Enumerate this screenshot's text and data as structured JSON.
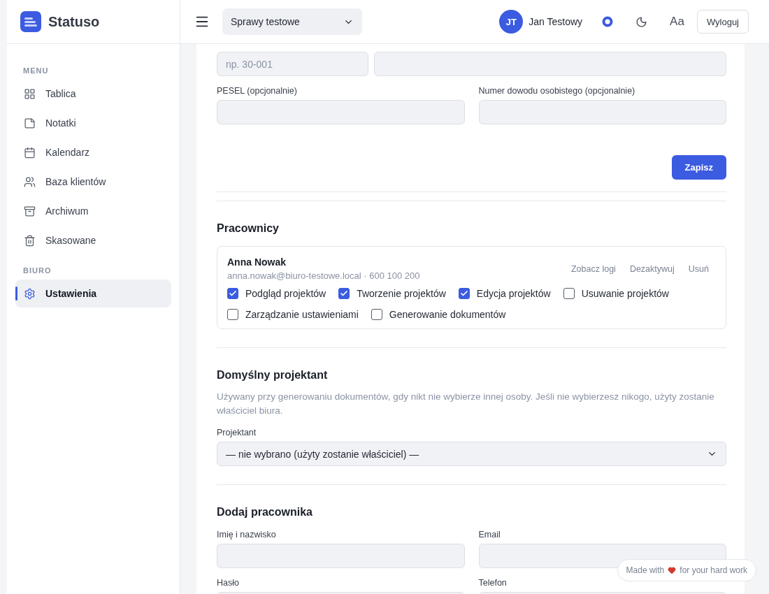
{
  "brand": {
    "name": "Statuso"
  },
  "sidebar": {
    "sections": [
      {
        "heading": "MENU",
        "items": [
          {
            "label": "Tablica",
            "selected": false
          },
          {
            "label": "Notatki",
            "selected": false
          },
          {
            "label": "Kalendarz",
            "selected": false
          },
          {
            "label": "Baza klientów",
            "selected": false
          },
          {
            "label": "Archiwum",
            "selected": false
          },
          {
            "label": "Skasowane",
            "selected": false
          }
        ]
      },
      {
        "heading": "BIURO",
        "items": [
          {
            "label": "Ustawienia",
            "selected": true
          }
        ]
      }
    ]
  },
  "header": {
    "case_select": "Sprawy testowe",
    "user": {
      "initials": "JT",
      "name": "Jan Testowy"
    },
    "font_toggle": "Aa",
    "logout": "Wyloguj"
  },
  "personal_form": {
    "rows": [
      [
        {
          "kind": "text",
          "placeholder": "np. 30-001"
        },
        {
          "kind": "text"
        }
      ],
      [
        {
          "kind": "text",
          "label": "PESEL (opcjonalnie)"
        },
        {
          "kind": "text",
          "label": "Numer dowodu osobistego (opcjonalnie)"
        }
      ]
    ],
    "save_button": "Zapisz"
  },
  "employees": {
    "title": "Pracownicy",
    "items": [
      {
        "name": "Anna Nowak",
        "contact": "anna.nowak@biuro-testowe.local · 600 100 200",
        "actions": [
          "Zobacz logi",
          "Dezaktywuj",
          "Usuń"
        ],
        "permissions": [
          {
            "label": "Podgląd projektów",
            "checked": true
          },
          {
            "label": "Tworzenie projektów",
            "checked": true
          },
          {
            "label": "Edycja projektów",
            "checked": true
          },
          {
            "label": "Usuwanie projektów",
            "checked": false
          },
          {
            "label": "Zarządzanie ustawieniami",
            "checked": false
          },
          {
            "label": "Generowanie dokumentów",
            "checked": false
          }
        ]
      }
    ]
  },
  "default_designer": {
    "title": "Domyślny projektant",
    "description": "Używany przy generowaniu dokumentów, gdy nikt nie wybierze innej osoby. Jeśli nie wybierzesz nikogo, użyty zostanie właściciel biura.",
    "field_label": "Projektant",
    "select_value": "— nie wybrano (użyty zostanie właściciel) —"
  },
  "add_employee": {
    "title": "Dodaj pracownika",
    "fields": [
      {
        "label": "Imię i nazwisko"
      },
      {
        "label": "Email"
      },
      {
        "label": "Hasło"
      },
      {
        "label": "Telefon"
      }
    ]
  },
  "footer_badge": {
    "before": "Made with",
    "after": "for your hard work"
  }
}
